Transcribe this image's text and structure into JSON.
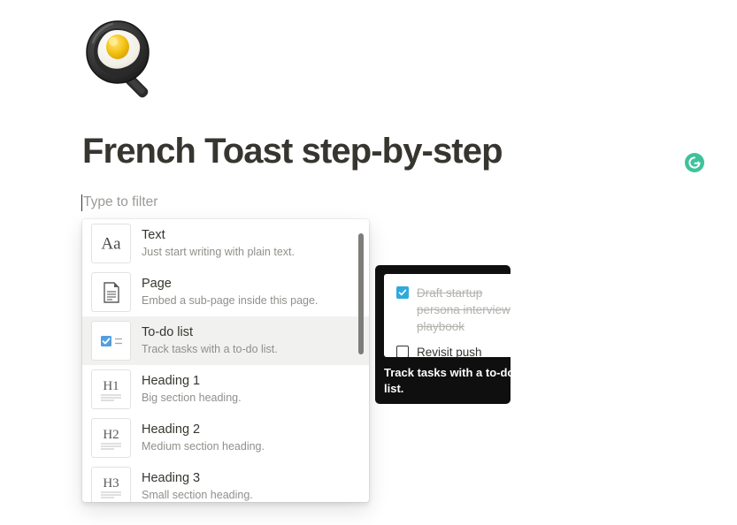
{
  "page": {
    "emoji_icon": "fried-egg-in-pan-emoji",
    "title": "French Toast step-by-step"
  },
  "filter": {
    "placeholder": "Type to filter",
    "value": ""
  },
  "block_menu": {
    "items": [
      {
        "icon": "text-aa-icon",
        "title": "Text",
        "description": "Just start writing with plain text.",
        "selected": false
      },
      {
        "icon": "page-document-icon",
        "title": "Page",
        "description": "Embed a sub-page inside this page.",
        "selected": false
      },
      {
        "icon": "todo-checkbox-icon",
        "title": "To-do list",
        "description": "Track tasks with a to-do list.",
        "selected": true
      },
      {
        "icon": "heading-1-icon",
        "title": "Heading 1",
        "description": "Big section heading.",
        "selected": false
      },
      {
        "icon": "heading-2-icon",
        "title": "Heading 2",
        "description": "Medium section heading.",
        "selected": false
      },
      {
        "icon": "heading-3-icon",
        "title": "Heading 3",
        "description": "Small section heading.",
        "selected": false
      }
    ]
  },
  "preview_tooltip": {
    "todos": [
      {
        "label": "Draft startup persona interview playbook",
        "checked": true
      },
      {
        "label": "Revisit push notification strategy",
        "checked": false
      }
    ],
    "caption": "Track tasks with a to-do list."
  },
  "badge": {
    "icon": "grammarly-g-icon",
    "color": "#3ec29a"
  },
  "colors": {
    "accent_blue": "#2eaadc",
    "text_primary": "#37352f",
    "text_secondary": "#908f8b",
    "selected_row": "#f1f1ef",
    "tooltip_bg": "#0f0f0f"
  }
}
